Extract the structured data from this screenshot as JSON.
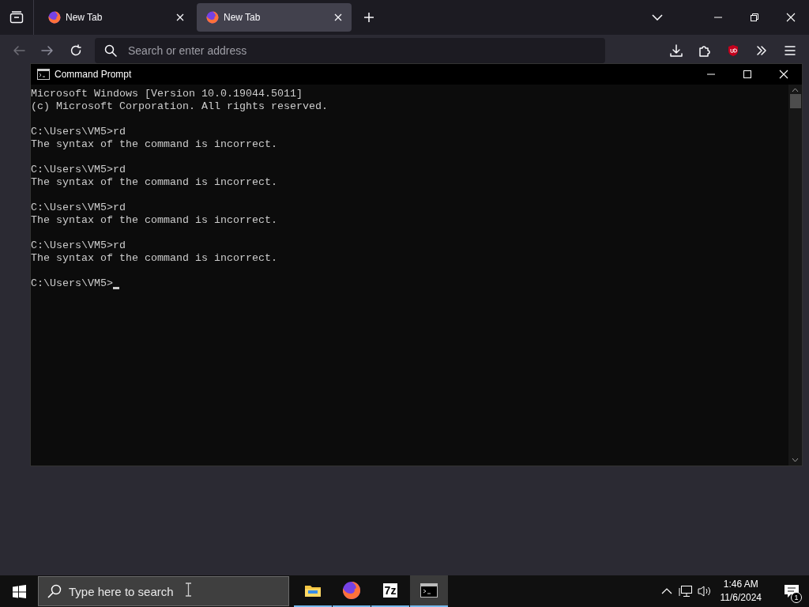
{
  "browser": {
    "tabs": [
      {
        "title": "New Tab",
        "selected": false
      },
      {
        "title": "New Tab",
        "selected": true
      }
    ],
    "address_bar": {
      "placeholder": "Search or enter address"
    }
  },
  "cmd_window": {
    "title": "Command Prompt",
    "blocks": [
      {
        "lines": [
          "Microsoft Windows [Version 10.0.19044.5011]",
          "(c) Microsoft Corporation. All rights reserved."
        ]
      },
      {
        "lines": [
          "C:\\Users\\VM5>rd",
          "The syntax of the command is incorrect."
        ]
      },
      {
        "lines": [
          "C:\\Users\\VM5>rd",
          "The syntax of the command is incorrect."
        ]
      },
      {
        "lines": [
          "C:\\Users\\VM5>rd",
          "The syntax of the command is incorrect."
        ]
      },
      {
        "lines": [
          "C:\\Users\\VM5>rd",
          "The syntax of the command is incorrect."
        ]
      }
    ],
    "prompt": "C:\\Users\\VM5>"
  },
  "taskbar": {
    "search": {
      "placeholder": "Type here to search"
    },
    "apps": [
      {
        "kind": "folder",
        "active": false
      },
      {
        "kind": "firefox",
        "active": false
      },
      {
        "kind": "archiver",
        "label": "7z",
        "active": false
      },
      {
        "kind": "terminal",
        "active": true
      }
    ],
    "time": "1:46 AM",
    "date": "11/6/2024",
    "notification_count": "1"
  }
}
